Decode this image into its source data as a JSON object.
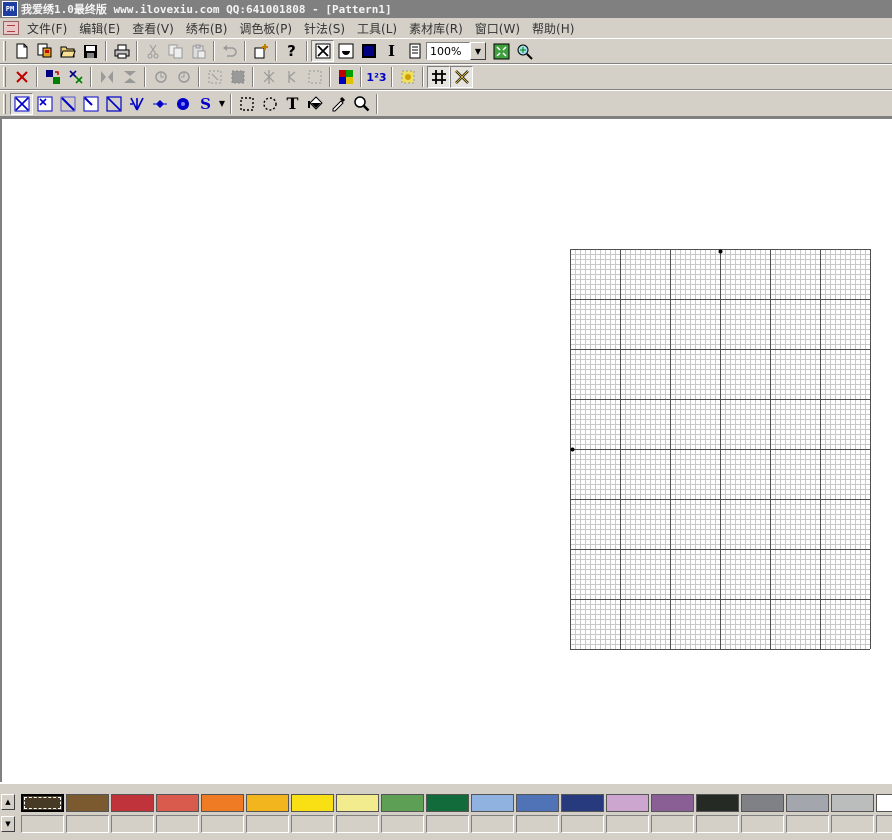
{
  "window": {
    "title": "我爱绣1.0最终版 www.ilovexiu.com QQ:641001808 - [Pattern1]",
    "app_icon_text": "PM"
  },
  "menu": [
    {
      "label": "文件(F)"
    },
    {
      "label": "编辑(E)"
    },
    {
      "label": "查看(V)"
    },
    {
      "label": "绣布(B)"
    },
    {
      "label": "调色板(P)"
    },
    {
      "label": "针法(S)"
    },
    {
      "label": "工具(L)"
    },
    {
      "label": "素材库(R)"
    },
    {
      "label": "窗口(W)"
    },
    {
      "label": "帮助(H)"
    }
  ],
  "toolbar1": {
    "zoom_value": "100%",
    "buttons": [
      "new-file-icon",
      "open-template-icon",
      "open-folder-icon",
      "save-icon",
      "print-icon",
      "cut-icon",
      "copy-icon",
      "paste-icon",
      "undo-icon",
      "insert-object-icon",
      "help-icon",
      "full-stitch-view-icon",
      "symbol-view-icon",
      "block-view-icon",
      "text-cursor-icon",
      "page-icon",
      "zoom-fit-icon",
      "zoom-tool-icon"
    ]
  },
  "toolbar2": {
    "buttons": [
      "delete-icon",
      "replace-color-icon",
      "swap-color-icon",
      "flip-horizontal-icon",
      "flip-vertical-icon",
      "rotate-left-icon",
      "rotate-right-icon",
      "select-all-icon",
      "fill-area-icon",
      "mirror-icon",
      "half-mirror-icon",
      "crop-icon",
      "color-grid-icon",
      "numbering-icon",
      "highlight-icon",
      "grid-toggle-icon",
      "cross-view-icon"
    ]
  },
  "toolbar3": {
    "text_tool_label": "T",
    "stitch_s_label": "S",
    "numbering_label": "1²3",
    "help_label": "?"
  },
  "palette": {
    "colors": [
      "#463a24",
      "#7b5a2f",
      "#c1333a",
      "#d95b4e",
      "#ef7c25",
      "#f3b51d",
      "#f9e015",
      "#f2ec8f",
      "#5d9f54",
      "#126b3b",
      "#8fb2e0",
      "#4f73b6",
      "#273a7e",
      "#cda6cf",
      "#8a5f96",
      "#262a24",
      "#7f8187",
      "#a3a6ad",
      "#bbbdbd",
      "#ffffff"
    ],
    "selected_index": 0
  }
}
